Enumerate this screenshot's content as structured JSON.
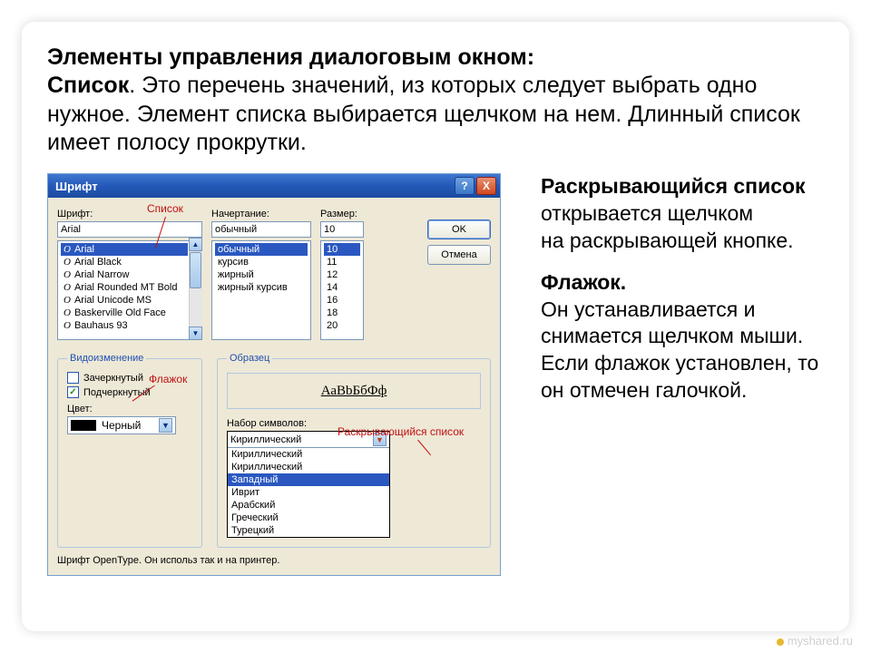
{
  "description": {
    "heading": "Элементы управления диалоговым окном:",
    "list_bold": "Список",
    "list_text": ". Это перечень значений, из которых следует выбрать одно нужное. Элемент списка выбирается щелчком на нем. Длинный список имеет полосу прокрутки."
  },
  "right": {
    "dropdown_bold": "Раскрывающийся список",
    "dropdown_text": " открывается щелчком",
    "dropdown_text2": " на раскрывающей кнопке.",
    "checkbox_bold": "Флажок.",
    "checkbox_text": "Он устанавливается и снимается щелчком мыши. Если флажок установлен, то он отмечен галочкой."
  },
  "watermark": "myshared.ru",
  "dialog": {
    "title": "Шрифт",
    "help": "?",
    "close": "X",
    "labels": {
      "font": "Шрифт:",
      "style": "Начертание:",
      "size": "Размер:",
      "effects": "Видоизменение",
      "sample": "Образец",
      "color": "Цвет:",
      "charset": "Набор символов:"
    },
    "values": {
      "font": "Arial",
      "style": "обычный",
      "size": "10",
      "color_name": "Черный",
      "sample": "АаВbБбФф",
      "charset_sel": "Кириллический"
    },
    "buttons": {
      "ok": "OK",
      "cancel": "Отмена"
    },
    "font_list": [
      "Arial",
      "Arial Black",
      "Arial Narrow",
      "Arial Rounded MT Bold",
      "Arial Unicode MS",
      "Baskerville Old Face",
      "Bauhaus 93"
    ],
    "style_list": [
      "обычный",
      "курсив",
      "жирный",
      "жирный курсив"
    ],
    "size_list": [
      "10",
      "11",
      "12",
      "14",
      "16",
      "18",
      "20"
    ],
    "checkboxes": {
      "strike": "Зачеркнутый",
      "underline": "Подчеркнутый"
    },
    "charset_list": [
      "Кириллический",
      "Кириллический",
      "Западный",
      "Иврит",
      "Арабский",
      "Греческий",
      "Турецкий"
    ],
    "charset_selected_index": 2,
    "note": "Шрифт OpenType. Он использ\nтак и на принтер."
  },
  "annotations": {
    "list": "Список",
    "checkbox": "Флажок",
    "dropdown": "Раскрывающийся список"
  }
}
